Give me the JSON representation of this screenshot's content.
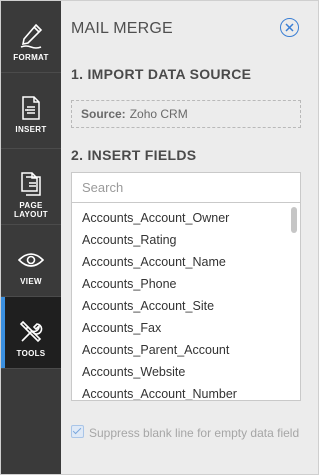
{
  "rail": {
    "items": [
      {
        "label": "FORMAT",
        "icon": "format-pen-icon"
      },
      {
        "label": "INSERT",
        "icon": "insert-document-icon"
      },
      {
        "label_line1": "PAGE",
        "label_line2": "LAYOUT",
        "icon": "page-layout-icon"
      },
      {
        "label": "VIEW",
        "icon": "eye-icon"
      },
      {
        "label": "TOOLS",
        "icon": "tools-icon"
      }
    ],
    "active": "TOOLS"
  },
  "panel": {
    "title": "MAIL MERGE",
    "section1": "1. IMPORT DATA SOURCE",
    "source_key": "Source:",
    "source_value": "Zoho CRM",
    "section2": "2. INSERT FIELDS",
    "search_placeholder": "Search",
    "fields": [
      "Accounts_Account_Owner",
      "Accounts_Rating",
      "Accounts_Account_Name",
      "Accounts_Phone",
      "Accounts_Account_Site",
      "Accounts_Fax",
      "Accounts_Parent_Account",
      "Accounts_Website",
      "Accounts_Account_Number"
    ],
    "suppress_label": "Suppress blank line for empty data field",
    "suppress_checked": true
  },
  "colors": {
    "accent": "#3b90e0",
    "rail_bg": "#3a3a3a",
    "panel_bg": "#ececec"
  }
}
